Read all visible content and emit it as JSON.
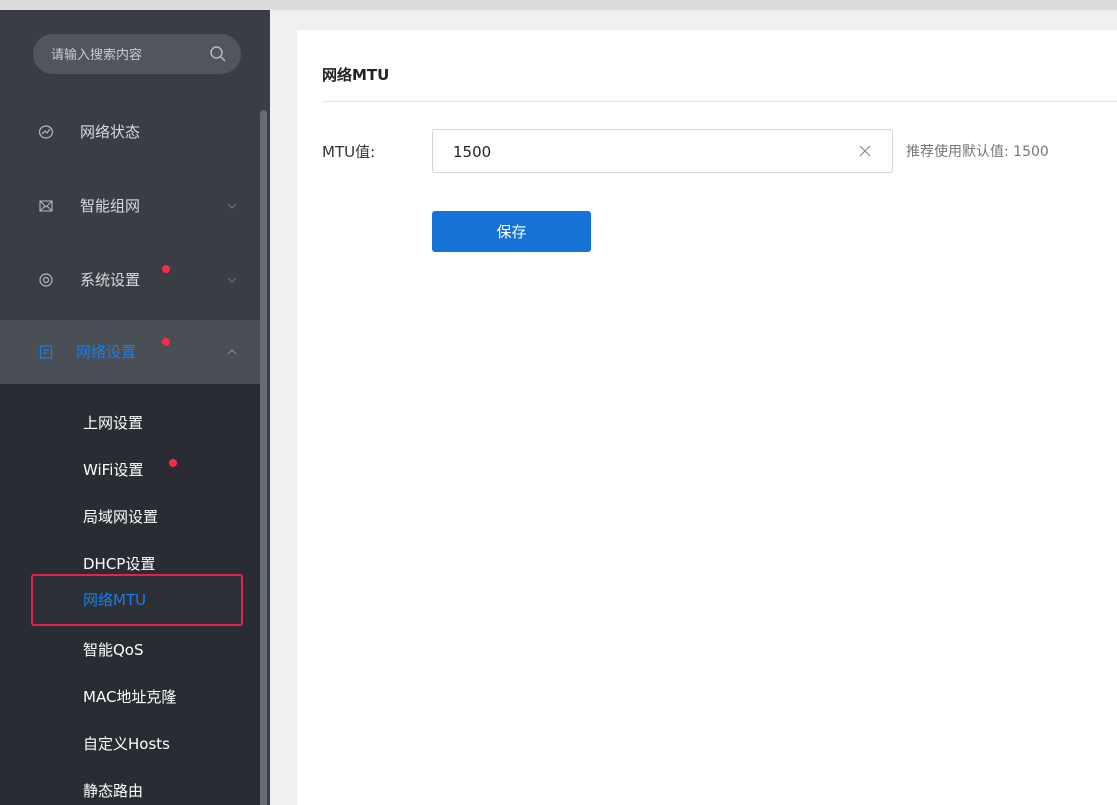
{
  "search": {
    "placeholder": "请输入搜索内容"
  },
  "menu": [
    {
      "label": "网络状态",
      "icon": "network-status-icon"
    },
    {
      "label": "智能组网",
      "icon": "mesh-icon"
    },
    {
      "label": "系统设置",
      "icon": "gear-icon"
    },
    {
      "label": "网络设置",
      "icon": "document-icon"
    }
  ],
  "submenu": [
    {
      "label": "上网设置"
    },
    {
      "label": "WiFi设置"
    },
    {
      "label": "局域网设置"
    },
    {
      "label": "DHCP设置"
    },
    {
      "label": "网络MTU"
    },
    {
      "label": "智能QoS"
    },
    {
      "label": "MAC地址克隆"
    },
    {
      "label": "自定义Hosts"
    },
    {
      "label": "静态路由"
    }
  ],
  "content": {
    "title": "网络MTU",
    "mtu_label": "MTU值:",
    "mtu_value": "1500",
    "hint": "推荐使用默认值: 1500",
    "save_label": "保存"
  },
  "colors": {
    "accent": "#1673d6",
    "active_text": "#1b7de6",
    "badge": "#ff2a44",
    "highlight_border": "#e5224f"
  }
}
